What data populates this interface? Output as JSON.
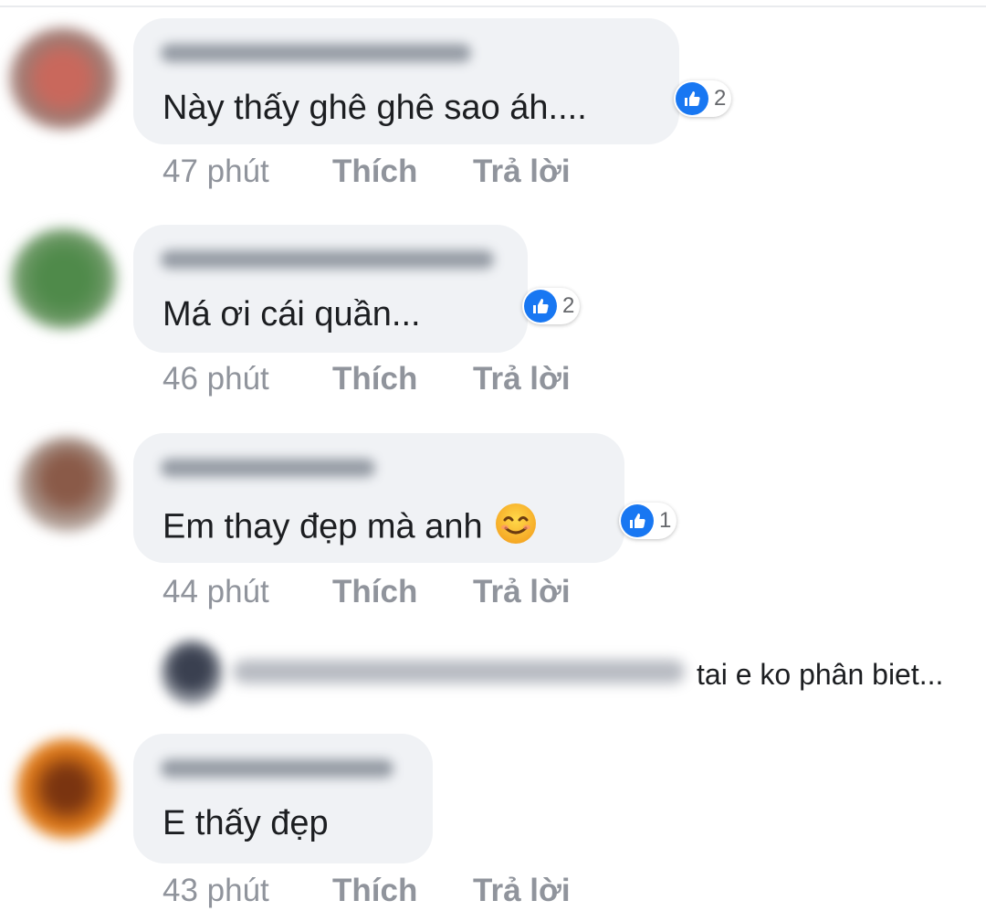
{
  "comments": [
    {
      "text": "Này thấy ghê ghê sao áh....",
      "reactions": "2",
      "time": "47 phút",
      "like_label": "Thích",
      "reply_label": "Trả lời"
    },
    {
      "text": "Má ơi cái quần...",
      "reactions": "2",
      "time": "46 phút",
      "like_label": "Thích",
      "reply_label": "Trả lời"
    },
    {
      "text": "Em thay đẹp mà anh",
      "reactions": "1",
      "time": "44 phút",
      "like_label": "Thích",
      "reply_label": "Trả lời"
    },
    {
      "text": "E thấy đẹp",
      "time": "43 phút",
      "like_label": "Thích",
      "reply_label": "Trả lời"
    }
  ],
  "reply_preview": {
    "text": "tai e ko phân biet..."
  },
  "icons": {
    "like": "thumbs-up-icon",
    "emoji": "smiling-face-icon"
  },
  "colors": {
    "like_blue": "#1877f2",
    "bubble_gray": "#f0f2f5",
    "meta_gray": "#90949c"
  }
}
